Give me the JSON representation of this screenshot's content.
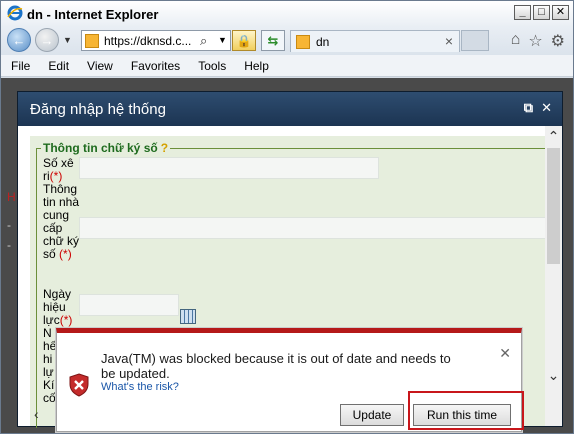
{
  "window": {
    "title": "dn - Internet Explorer"
  },
  "navbar": {
    "address_url": "https://dknsd.c...",
    "tab_label": "dn"
  },
  "menu": [
    "File",
    "Edit",
    "View",
    "Favorites",
    "Tools",
    "Help"
  ],
  "dialog": {
    "title": "Đăng nhập hệ thống",
    "section_title": "Thông tin chữ ký số",
    "help_mark": "?",
    "fields": [
      {
        "label": "Số xê ri",
        "required": "(*)"
      },
      {
        "label": "Thông tin nhà cung cấp chữ ký số",
        "required": "(*)"
      },
      {
        "label": "Ngày hiệu lực",
        "required": "(*)"
      }
    ],
    "label_fragments": [
      "N",
      "hế",
      "hi",
      "lự",
      "Kí",
      "cố"
    ]
  },
  "java_popup": {
    "message": "Java(TM) was blocked because it is out of date and needs to be updated.",
    "link": "What's the risk?",
    "update_button": "Update",
    "run_button": "Run this time"
  },
  "colors": {
    "highlight": "#c8161b",
    "dialog_header": "#1f3854",
    "required": "#cc0000",
    "section_title": "#1e6b1e"
  }
}
